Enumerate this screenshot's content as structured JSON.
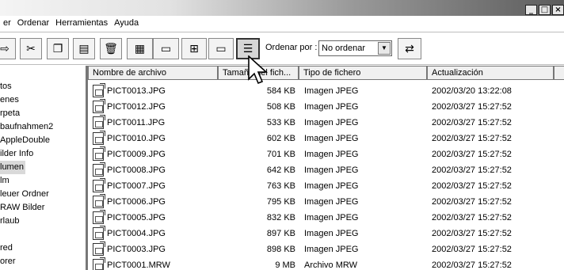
{
  "window": {
    "buttons": [
      "_",
      "□",
      "×"
    ]
  },
  "menubar": {
    "items": [
      "er",
      "Ordenar",
      "Herramientas",
      "Ayuda"
    ]
  },
  "toolbar": {
    "order_label": "Ordenar por :",
    "order_value": "No ordenar",
    "icons": [
      "move-icon",
      "cut-icon",
      "copy-icon",
      "paste-icon",
      "delete-icon",
      "thumbnail-view-icon",
      "camera-import-icon",
      "large-icons-view-icon",
      "small-icons-view-icon",
      "details-view-icon",
      "reverse-order-icon"
    ]
  },
  "sidebar": {
    "folders": [
      "tos",
      "enes",
      "rpeta",
      "baufnahmen2",
      "AppleDouble",
      "ilder Info",
      "lumen",
      "lm",
      "leuer Ordner",
      "RAW Bilder",
      "rlaub",
      "",
      "red",
      "orer"
    ]
  },
  "table": {
    "headers": [
      "Nombre de archivo",
      "Tamaño del fich...",
      "Tipo de fichero",
      "Actualización"
    ],
    "rows": [
      [
        "PICT0013.JPG",
        "584 KB",
        "Imagen JPEG",
        "2002/03/20 13:22:08"
      ],
      [
        "PICT0012.JPG",
        "508 KB",
        "Imagen JPEG",
        "2002/03/27 15:27:52"
      ],
      [
        "PICT0011.JPG",
        "533 KB",
        "Imagen JPEG",
        "2002/03/27 15:27:52"
      ],
      [
        "PICT0010.JPG",
        "602 KB",
        "Imagen JPEG",
        "2002/03/27 15:27:52"
      ],
      [
        "PICT0009.JPG",
        "701 KB",
        "Imagen JPEG",
        "2002/03/27 15:27:52"
      ],
      [
        "PICT0008.JPG",
        "642 KB",
        "Imagen JPEG",
        "2002/03/27 15:27:52"
      ],
      [
        "PICT0007.JPG",
        "763 KB",
        "Imagen JPEG",
        "2002/03/27 15:27:52"
      ],
      [
        "PICT0006.JPG",
        "795 KB",
        "Imagen JPEG",
        "2002/03/27 15:27:52"
      ],
      [
        "PICT0005.JPG",
        "832 KB",
        "Imagen JPEG",
        "2002/03/27 15:27:52"
      ],
      [
        "PICT0004.JPG",
        "897 KB",
        "Imagen JPEG",
        "2002/03/27 15:27:52"
      ],
      [
        "PICT0003.JPG",
        "898 KB",
        "Imagen JPEG",
        "2002/03/27 15:27:52"
      ],
      [
        "PICT0001.MRW",
        "9 MB",
        "Archivo MRW",
        "2002/03/27 15:27:52"
      ]
    ]
  }
}
